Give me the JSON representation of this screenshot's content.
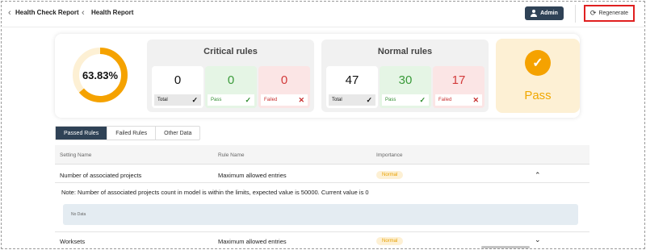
{
  "header": {
    "breadcrumb": [
      {
        "label": "Health Check Report"
      },
      {
        "label": "Health Report"
      }
    ],
    "admin_label": "Admin",
    "regenerate_label": "Regenerate"
  },
  "summary": {
    "score_label": "63.83%",
    "score_fraction": 0.6383,
    "critical": {
      "title": "Critical rules",
      "total": {
        "value": "0",
        "label": "Total"
      },
      "pass": {
        "value": "0",
        "label": "Pass"
      },
      "failed": {
        "value": "0",
        "label": "Failed"
      }
    },
    "normal": {
      "title": "Normal rules",
      "total": {
        "value": "47",
        "label": "Total"
      },
      "pass": {
        "value": "30",
        "label": "Pass"
      },
      "failed": {
        "value": "17",
        "label": "Failed"
      }
    },
    "status": {
      "label": "Pass",
      "color": "#f5a200"
    }
  },
  "tabs": [
    {
      "label": "Passed Rules",
      "active": true
    },
    {
      "label": "Failed Rules",
      "active": false
    },
    {
      "label": "Other Data",
      "active": false
    }
  ],
  "table": {
    "columns": [
      "Setting Name",
      "Rule Name",
      "Importance"
    ],
    "rows": [
      {
        "setting": "Number of associated projects",
        "rule": "Maximum allowed entries",
        "importance": "Normal",
        "expanded": true,
        "note": "Note: Number of associated projects count in model is within the limits, expected value is 50000. Current value is 0",
        "detail": "No Data"
      },
      {
        "setting": "Worksets",
        "rule": "Maximum allowed entries",
        "importance": "Normal",
        "expanded": false
      }
    ]
  },
  "colors": {
    "accent": "#2f4256",
    "warning": "#f5a200",
    "pass": "#3a9a3a",
    "fail": "#d23a3a",
    "highlight_border": "#e02020"
  },
  "icons": {
    "back": "chevron-left-icon",
    "admin": "user-icon",
    "regenerate": "refresh-icon",
    "total": "check-icon",
    "pass": "check-icon",
    "failed": "close-icon",
    "status": "check-circle-icon",
    "expand": "chevron-up-icon",
    "collapse": "chevron-down-icon"
  }
}
